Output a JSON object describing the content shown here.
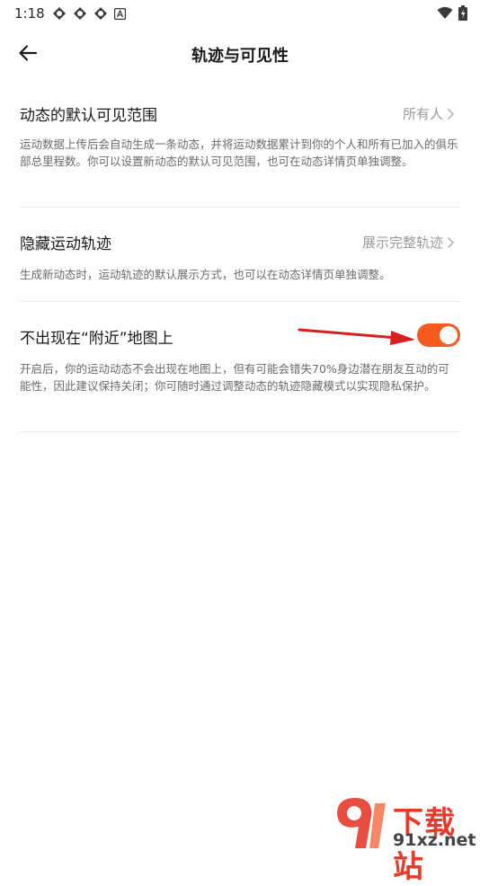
{
  "status_bar": {
    "time": "1:18",
    "left_icons": [
      "app-notification-icon",
      "app-notification-icon",
      "app-notification-icon",
      "a-badge-icon"
    ],
    "right_icons": [
      "wifi-icon",
      "battery-icon"
    ]
  },
  "header": {
    "title": "轨迹与可见性"
  },
  "settings": {
    "visibility": {
      "title": "动态的默认可见范围",
      "value": "所有人",
      "description": "运动数据上传后会自动生成一条动态，并将运动数据累计到你的个人和所有已加入的俱乐部总里程数。你可以设置新动态的默认可见范围，也可在动态详情页单独调整。"
    },
    "hide_track": {
      "title": "隐藏运动轨迹",
      "value": "展示完整轨迹",
      "description": "生成新动态时，运动轨迹的默认展示方式，也可以在动态详情页单独调整。"
    },
    "nearby": {
      "title": "不出现在“附近”地图上",
      "enabled": true,
      "description": "开启后，你的运动动态不会出现在地图上，但有可能会错失70%身边潜在朋友互动的可能性，因此建议保持关闭；你可随时通过调整动态的轨迹隐藏模式以实现隐私保护。"
    }
  },
  "colors": {
    "accent": "#f55a1f",
    "annotation_arrow": "#d81e1e"
  },
  "watermark": {
    "text": "下载站",
    "url": "91xz.net"
  }
}
